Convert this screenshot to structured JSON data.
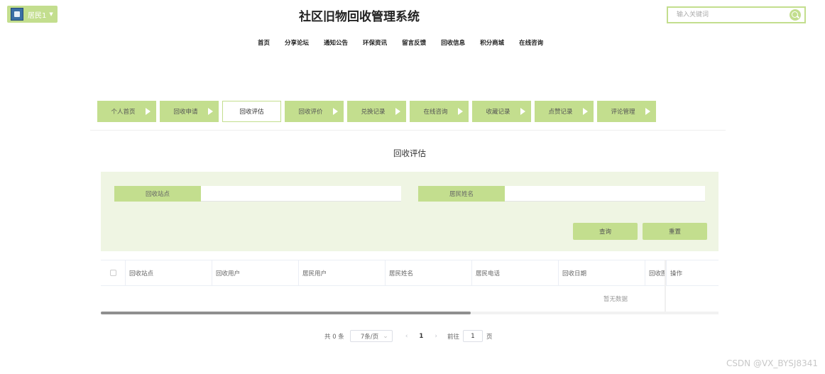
{
  "user": {
    "name": "居民1",
    "caret": "▼"
  },
  "site_title": "社区旧物回收管理系统",
  "search": {
    "placeholder": "输入关键词"
  },
  "nav": [
    "首页",
    "分享论坛",
    "通知公告",
    "环保资讯",
    "留言反馈",
    "回收信息",
    "积分商城",
    "在线咨询"
  ],
  "tabs": [
    {
      "label": "个人首页",
      "active": false
    },
    {
      "label": "回收申请",
      "active": false
    },
    {
      "label": "回收评估",
      "active": true
    },
    {
      "label": "回收评价",
      "active": false
    },
    {
      "label": "兑换记录",
      "active": false
    },
    {
      "label": "在线咨询",
      "active": false
    },
    {
      "label": "收藏记录",
      "active": false
    },
    {
      "label": "点赞记录",
      "active": false
    },
    {
      "label": "评论管理",
      "active": false
    }
  ],
  "page_heading": "回收评估",
  "filters": {
    "station_label": "回收站点",
    "station_value": "",
    "resident_label": "居民姓名",
    "resident_value": ""
  },
  "buttons": {
    "query": "查询",
    "reset": "重置"
  },
  "table": {
    "columns": [
      "回收站点",
      "回收用户",
      "居民用户",
      "居民姓名",
      "居民电话",
      "回收日期",
      "回收图"
    ],
    "operation": "操作",
    "empty_text": "暂无数据"
  },
  "pagination": {
    "total": "共 0 条",
    "page_size": "7条/页",
    "prev": "‹",
    "current": "1",
    "next": "›",
    "goto_label": "前往",
    "goto_value": "1",
    "page_suffix": "页"
  },
  "watermark": "CSDN @VX_BYSJ8341",
  "colors": {
    "accent": "#c3de8e",
    "panel": "#eff5e3"
  }
}
